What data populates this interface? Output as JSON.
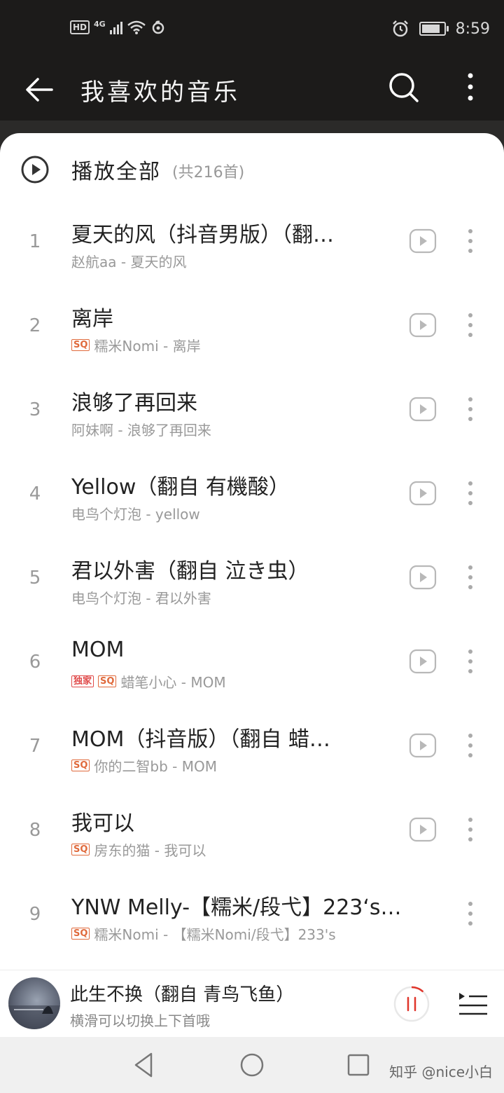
{
  "status_bar": {
    "hd": "HD",
    "network": "4G",
    "time": "8:59",
    "battery_level": 0.9
  },
  "header": {
    "title": "我喜欢的音乐",
    "icons": {
      "back": "back-arrow-icon",
      "search": "search-icon",
      "more": "more-vertical-icon"
    }
  },
  "play_all": {
    "label": "播放全部",
    "count": "(共216首)"
  },
  "songs": [
    {
      "index": "1",
      "title": "夏天的风（抖音男版）（翻…",
      "badges": [],
      "subtitle": "赵航aa - 夏天的风",
      "has_video": true
    },
    {
      "index": "2",
      "title": "离岸",
      "badges": [
        "SQ"
      ],
      "subtitle": "糯米Nomi - 离岸",
      "has_video": true
    },
    {
      "index": "3",
      "title": "浪够了再回来",
      "badges": [],
      "subtitle": "阿妹啊 - 浪够了再回来",
      "has_video": true
    },
    {
      "index": "4",
      "title": "Yellow（翻自 有機酸）",
      "badges": [],
      "subtitle": "电鸟个灯泡 - yellow",
      "has_video": true
    },
    {
      "index": "5",
      "title": "君以外害（翻自 泣き虫）",
      "badges": [],
      "subtitle": "电鸟个灯泡 - 君以外害",
      "has_video": true
    },
    {
      "index": "6",
      "title": "MOM",
      "badges": [
        "独家",
        "SQ"
      ],
      "subtitle": "蜡笔小心 - MOM",
      "has_video": true
    },
    {
      "index": "7",
      "title": "MOM（抖音版）（翻自 蜡…",
      "badges": [
        "SQ"
      ],
      "subtitle": "你的二智bb - MOM",
      "has_video": true
    },
    {
      "index": "8",
      "title": "我可以",
      "badges": [
        "SQ"
      ],
      "subtitle": "房东的猫 - 我可以",
      "has_video": true
    },
    {
      "index": "9",
      "title": "YNW Melly-【糯米/段弋】223‘s…",
      "badges": [
        "SQ"
      ],
      "subtitle": "糯米Nomi - 【糯米Nomi/段弋】233's",
      "has_video": false
    }
  ],
  "now_playing": {
    "title": "此生不换（翻自 青鸟飞鱼）",
    "subtitle": "横滑可以切换上下首哦",
    "progress": 0.12
  },
  "watermark": "知乎 @nice小白",
  "colors": {
    "accent": "#e0352b",
    "badge": "#e06a3c",
    "header_bg": "#1c1b1a"
  }
}
